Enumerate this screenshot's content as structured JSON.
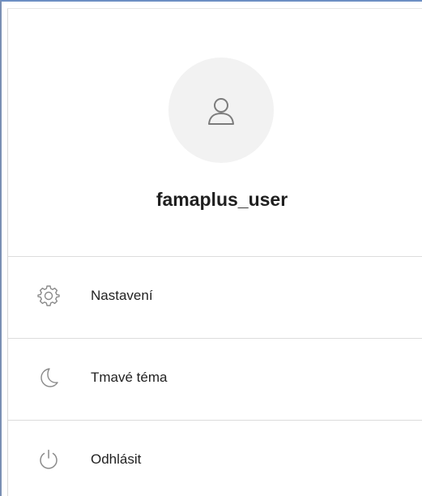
{
  "profile": {
    "avatar_icon": "user-outline-icon",
    "username": "famaplus_user"
  },
  "menu": {
    "items": [
      {
        "label": "Nastavení",
        "icon": "gear-icon"
      },
      {
        "label": "Tmavé téma",
        "icon": "moon-icon"
      },
      {
        "label": "Odhlásit",
        "icon": "power-icon"
      }
    ]
  },
  "colors": {
    "avatar_bg": "#f2f2f2",
    "text": "#222222",
    "divider": "#dcdcdc",
    "icon_stroke": "#8a8a8a"
  }
}
